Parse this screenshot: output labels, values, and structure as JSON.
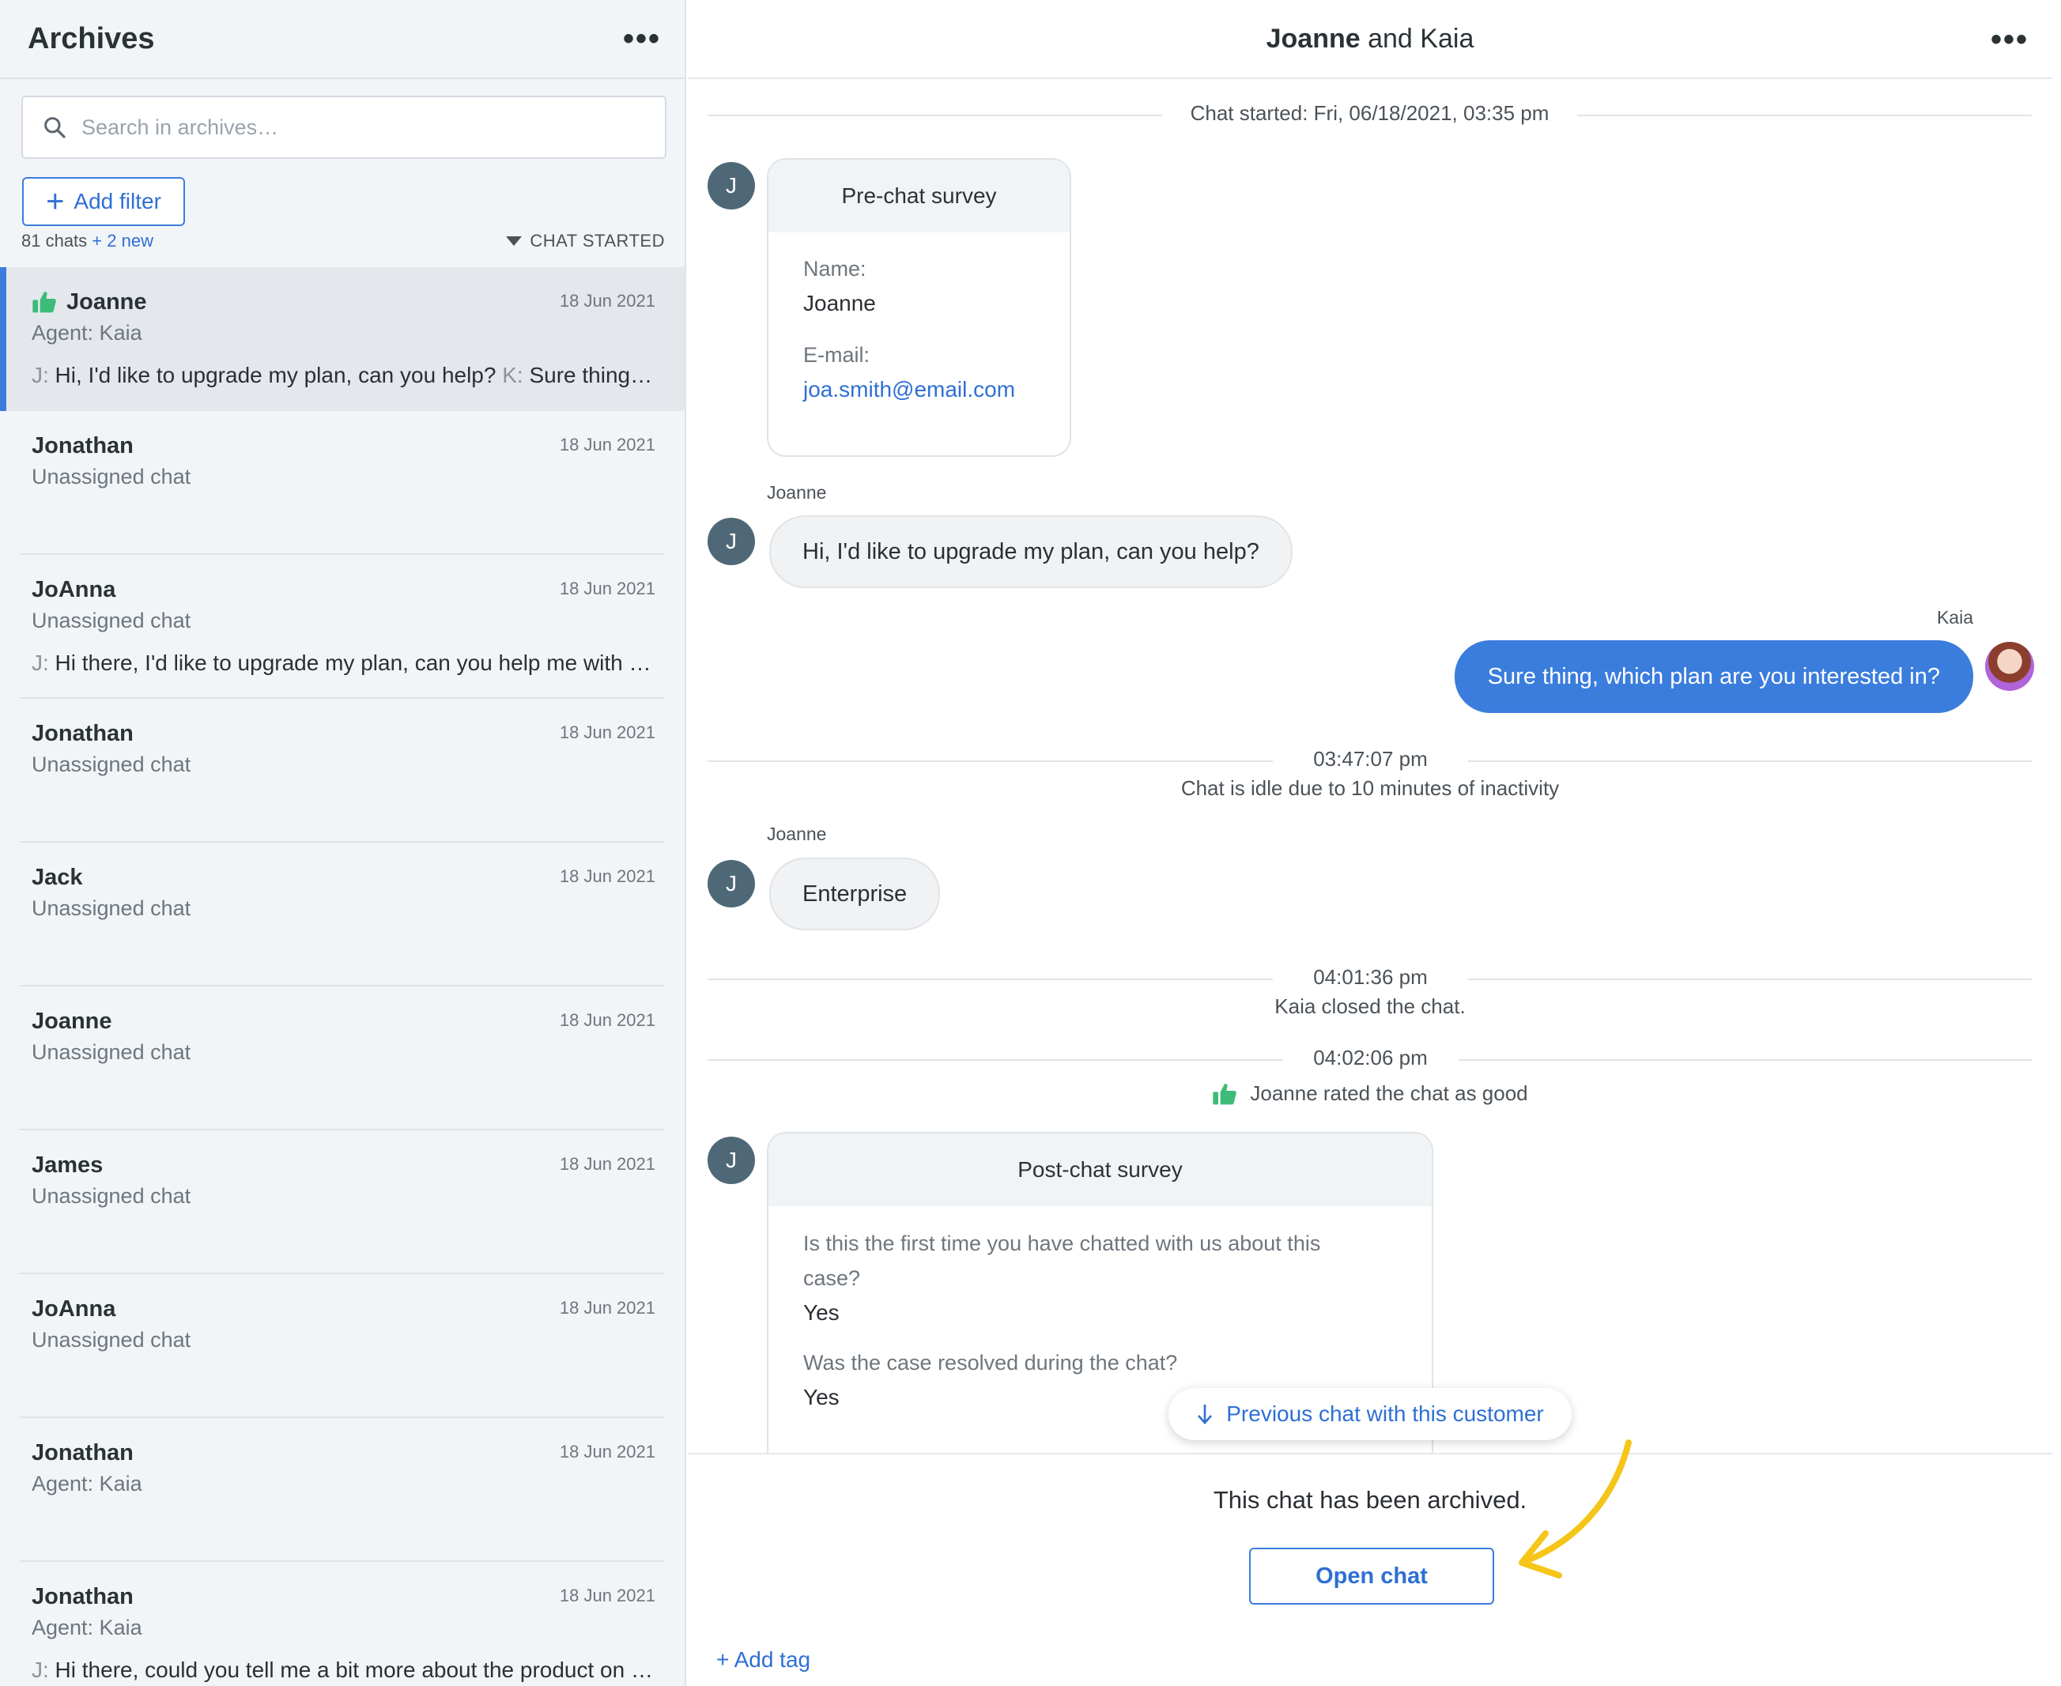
{
  "sidebar": {
    "title": "Archives",
    "search_placeholder": "Search in archives…",
    "add_filter_label": "Add filter",
    "chat_count": "81 chats",
    "new_count": "+ 2 new",
    "sort_label": "CHAT STARTED",
    "items": [
      {
        "name": "Joanne",
        "date": "18 Jun 2021",
        "sub": "Agent: Kaia",
        "rated": true,
        "msg_prefix1": "J:",
        "msg1": " Hi, I'd like to upgrade my plan, can you help? ",
        "msg_prefix2": "K:",
        "msg2": " Sure thing, which plan are you interested in?"
      },
      {
        "name": "Jonathan",
        "date": "18 Jun 2021",
        "sub": "Unassigned chat"
      },
      {
        "name": "JoAnna",
        "date": "18 Jun 2021",
        "sub": "Unassigned chat",
        "msg_prefix1": "J:",
        "msg1": " Hi there, I'd like to upgrade my plan, can you help me with that?"
      },
      {
        "name": "Jonathan",
        "date": "18 Jun 2021",
        "sub": "Unassigned chat"
      },
      {
        "name": "Jack",
        "date": "18 Jun 2021",
        "sub": "Unassigned chat"
      },
      {
        "name": "Joanne",
        "date": "18 Jun 2021",
        "sub": "Unassigned chat"
      },
      {
        "name": "James",
        "date": "18 Jun 2021",
        "sub": "Unassigned chat"
      },
      {
        "name": "JoAnna",
        "date": "18 Jun 2021",
        "sub": "Unassigned chat"
      },
      {
        "name": "Jonathan",
        "date": "18 Jun 2021",
        "sub": "Agent: Kaia"
      },
      {
        "name": "Jonathan",
        "date": "18 Jun 2021",
        "sub": "Agent: Kaia",
        "msg_prefix1": "J:",
        "msg1": " Hi there, could you tell me a bit more about the product on your site?"
      }
    ]
  },
  "chat": {
    "title_customer": "Joanne",
    "title_and": " and ",
    "title_agent": "Kaia",
    "started": "Chat started: Fri, 06/18/2021, 03:35 pm",
    "customer_initial": "J",
    "pre_survey": {
      "title": "Pre-chat survey",
      "name_q": "Name:",
      "name_a": "Joanne",
      "email_q": "E-mail:",
      "email_a": "joa.smith@email.com"
    },
    "msg1_author": "Joanne",
    "msg1": "Hi, I'd like to upgrade my plan, can you help?",
    "msg2_author": "Kaia",
    "msg2": "Sure thing, which plan are you interested in?",
    "idle_time": "03:47:07 pm",
    "idle_text": "Chat is idle due to 10 minutes of inactivity",
    "msg3_author": "Joanne",
    "msg3": "Enterprise",
    "closed_time": "04:01:36 pm",
    "closed_text": "Kaia closed the chat.",
    "rated_time": "04:02:06 pm",
    "rated_text": "Joanne rated the chat as good",
    "post_survey": {
      "title": "Post-chat survey",
      "q1": "Is this the first time you have chatted with us about this case?",
      "a1": "Yes",
      "q2": "Was the case resolved during the chat?",
      "a2": "Yes"
    },
    "prev_chat_label": "Previous chat with this customer",
    "archived_text": "This chat has been archived.",
    "open_chat_label": "Open chat",
    "add_tag_label": "+ Add tag"
  },
  "colors": {
    "accent": "#3b7ddd",
    "thumb_green": "#3dbb78",
    "annotation_arrow": "#f5c518"
  }
}
